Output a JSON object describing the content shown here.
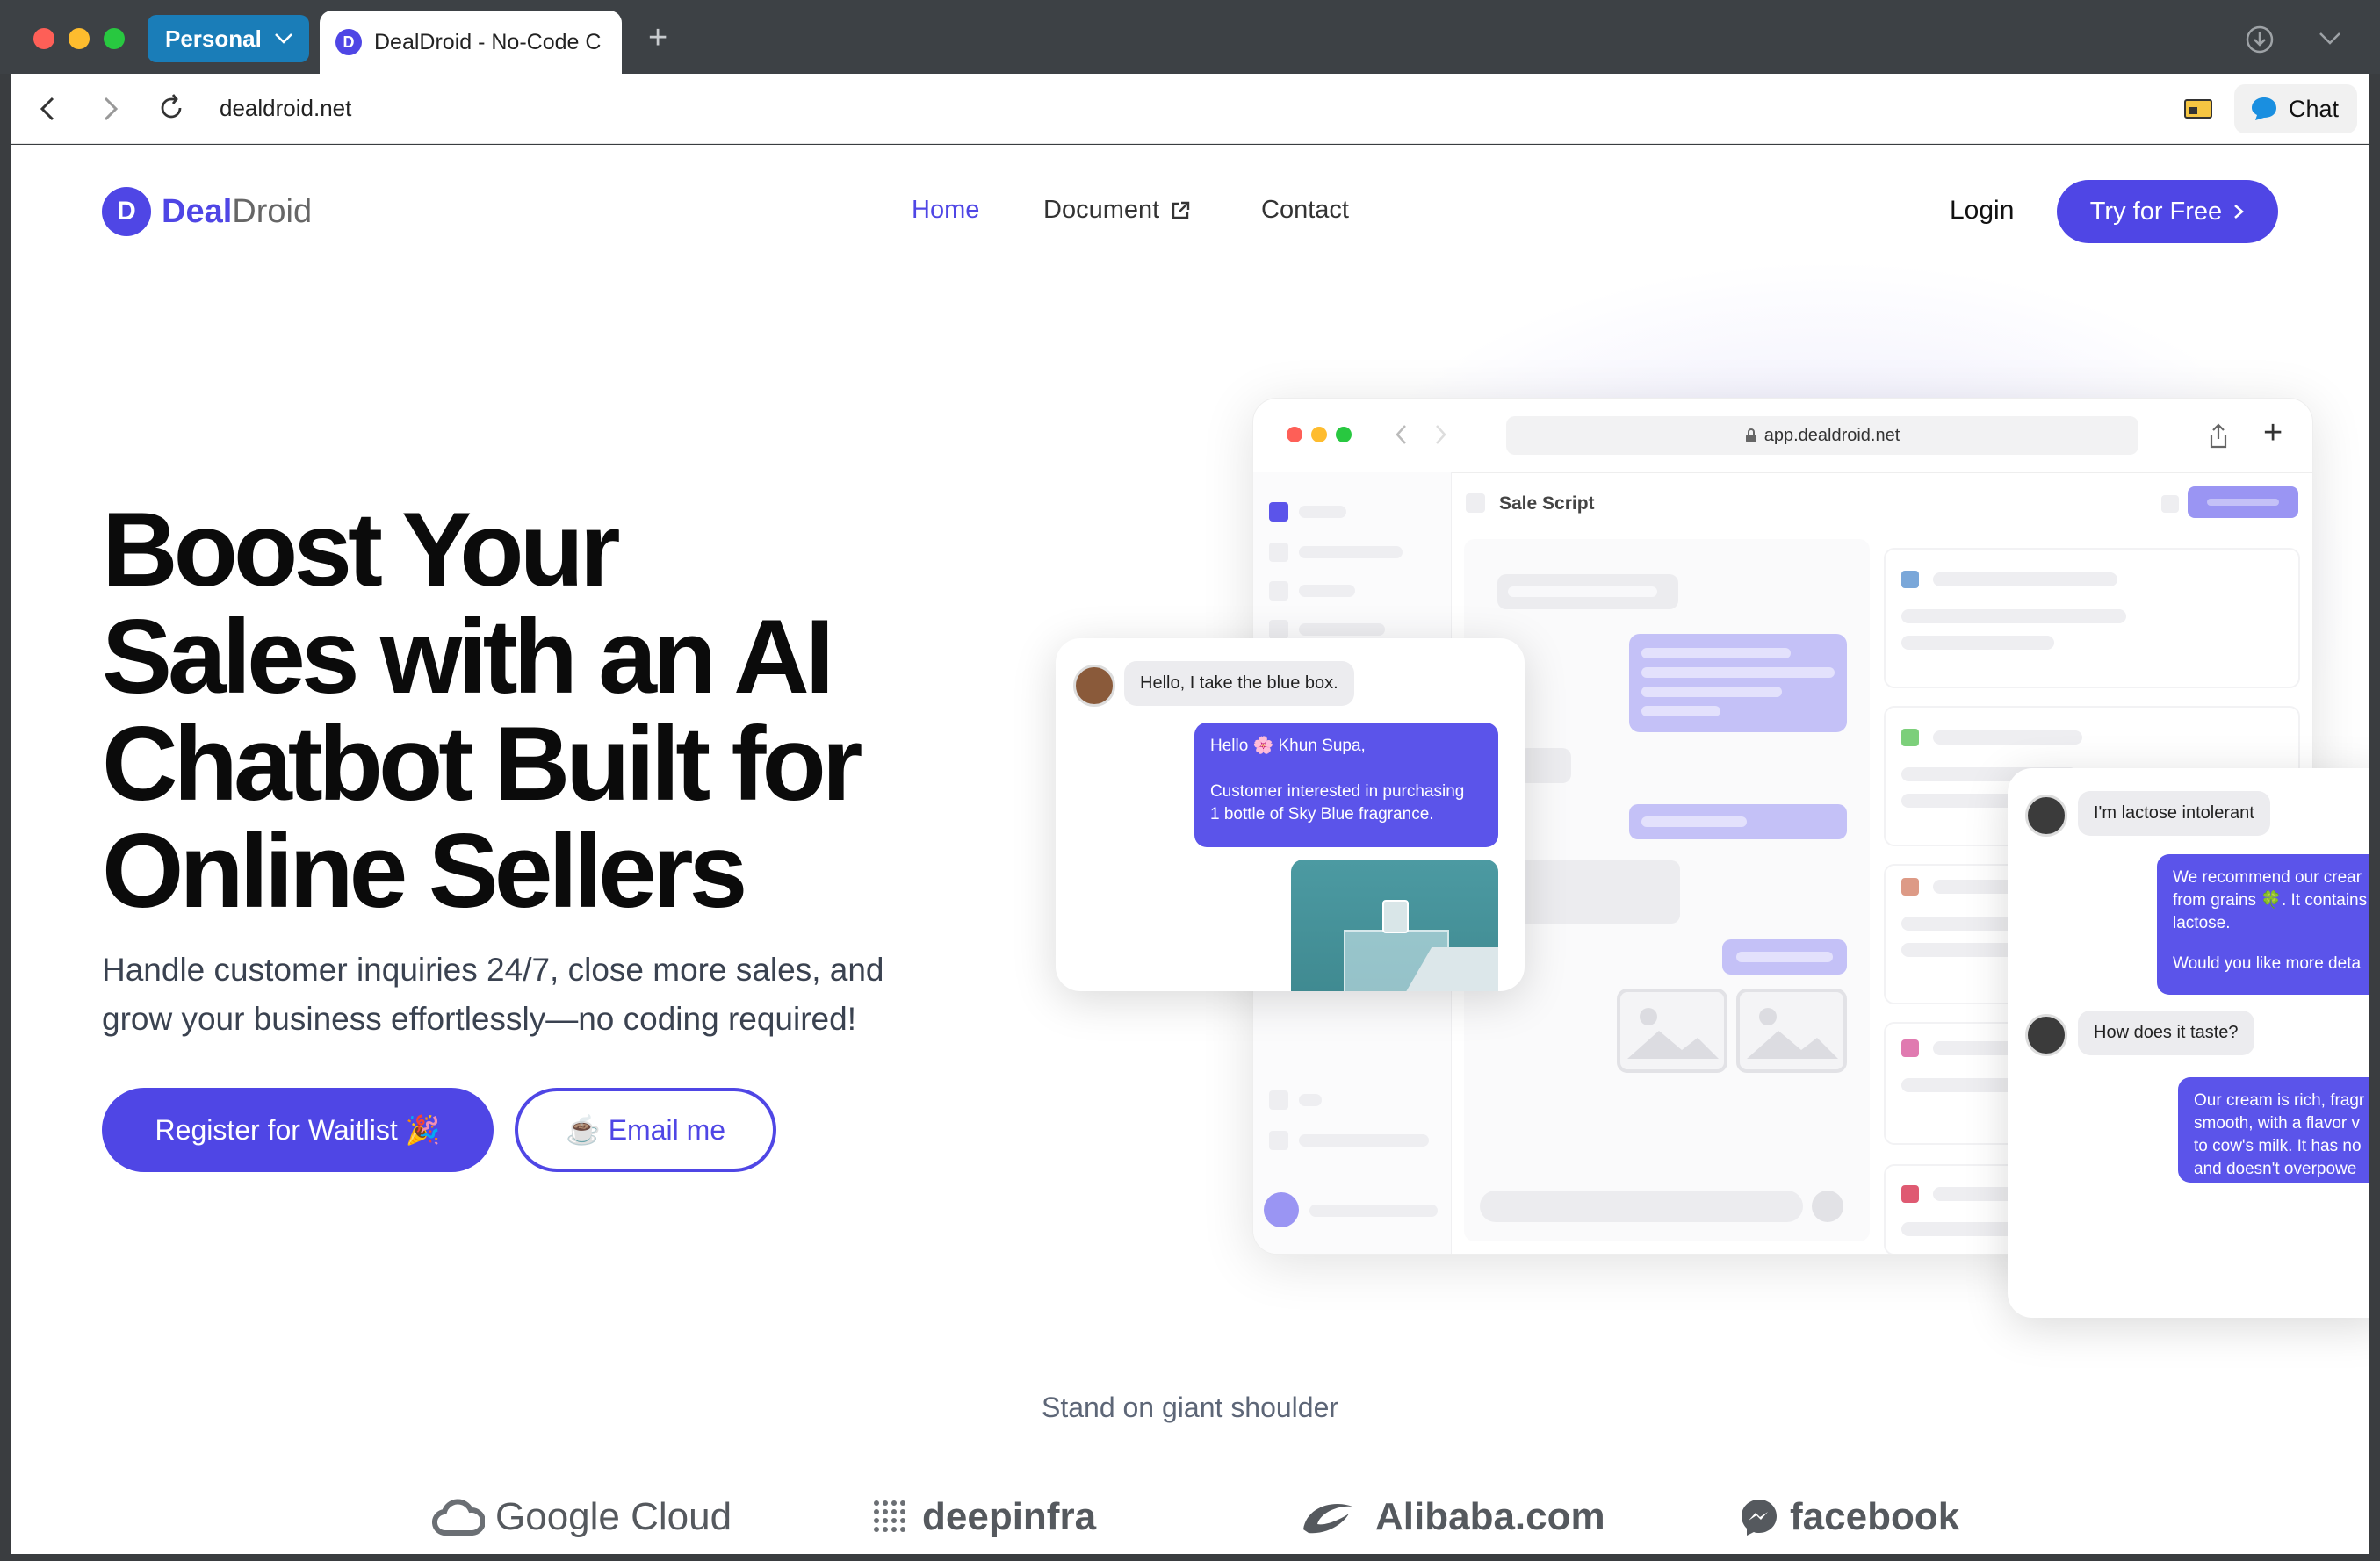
{
  "browser": {
    "profile_label": "Personal",
    "tab_title": "DealDroid - No-Code C",
    "favicon_letter": "D",
    "url": "dealdroid.net",
    "chat_label": "Chat"
  },
  "site": {
    "logo_letter": "D",
    "brand_primary": "Deal",
    "brand_secondary": "Droid",
    "nav": [
      {
        "label": "Home",
        "active": true
      },
      {
        "label": "Document",
        "external": true
      },
      {
        "label": "Contact"
      }
    ],
    "login_label": "Login",
    "cta_label": "Try for Free",
    "accent_color": "#4f46e5"
  },
  "hero": {
    "headline_lines": [
      "Boost Your",
      "Sales with an AI",
      "Chatbot Built for",
      "Online Sellers"
    ],
    "subtext_lines": [
      "Handle customer inquiries 24/7, close more sales, and",
      "grow your business effortlessly—no coding required!"
    ],
    "waitlist_label": "Register for Waitlist 🎉",
    "email_label": "☕ Email me"
  },
  "mockup": {
    "url": "app.dealdroid.net",
    "section_title": "Sale Script"
  },
  "chat_left": {
    "customer_msg": "Hello, I take the blue box.",
    "bot_greeting": "Hello 🌸 Khun Supa,",
    "bot_msg_lines": [
      "Customer interested in purchasing",
      "1 bottle of Sky Blue fragrance."
    ]
  },
  "chat_right": {
    "customer_msg_1": "I'm lactose intolerant",
    "bot_msg_1_lines": [
      "We recommend our crear",
      "from grains 🍀. It contains",
      "lactose."
    ],
    "bot_msg_1_follow": "Would you like more deta",
    "customer_msg_2": "How does it taste?",
    "bot_msg_2_lines": [
      "Our cream is rich, fragr",
      "smooth, with a flavor v",
      "to cow's milk. It has no",
      "and doesn't overpowe"
    ]
  },
  "partners": {
    "heading": "Stand on giant shoulder",
    "logos": [
      {
        "name": "Google Cloud",
        "icon": "cloud-icon"
      },
      {
        "name": "deepinfra",
        "icon": "dots-grid-icon"
      },
      {
        "name": "Alibaba.com",
        "icon": "alibaba-icon"
      },
      {
        "name": "facebook",
        "icon": "messenger-icon"
      }
    ]
  }
}
